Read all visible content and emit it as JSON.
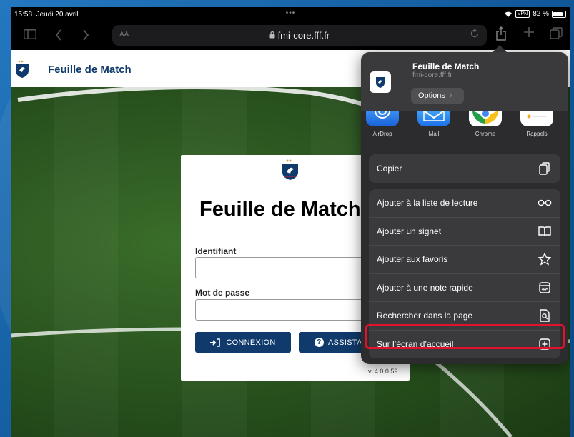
{
  "status_bar": {
    "time": "15:58",
    "date": "Jeudi 20 avril",
    "dots": "•••",
    "vpn": "VPN",
    "battery": "82 %"
  },
  "toolbar": {
    "text_size": "AA",
    "url": "fmi-core.fff.fr"
  },
  "web": {
    "header_title": "Feuille de Match",
    "card_title": "Feuille de Match",
    "username_label": "Identifiant",
    "password_label": "Mot de passe",
    "login_button": "CONNEXION",
    "assist_button": "ASSISTANCE",
    "version": "v. 4.0.0.59"
  },
  "share_sheet": {
    "title": "Feuille de Match",
    "url": "fmi-core.fff.fr",
    "options_label": "Options",
    "apps": [
      {
        "label": "AirDrop"
      },
      {
        "label": "Mail"
      },
      {
        "label": "Chrome"
      },
      {
        "label": "Rappels"
      }
    ],
    "copy_label": "Copier",
    "actions": [
      {
        "label": "Ajouter à la liste de lecture",
        "icon": "glasses-icon"
      },
      {
        "label": "Ajouter un signet",
        "icon": "book-icon"
      },
      {
        "label": "Ajouter aux favoris",
        "icon": "star-icon"
      },
      {
        "label": "Ajouter à une note rapide",
        "icon": "quick-note-icon"
      },
      {
        "label": "Rechercher dans la page",
        "icon": "find-in-page-icon"
      },
      {
        "label": "Sur l’écran d’accueil",
        "icon": "add-square-icon"
      }
    ]
  },
  "colors": {
    "fff_blue": "#0f3a6b",
    "highlight_red": "#e3112b",
    "sheet_bg": "#2c2c2e"
  }
}
